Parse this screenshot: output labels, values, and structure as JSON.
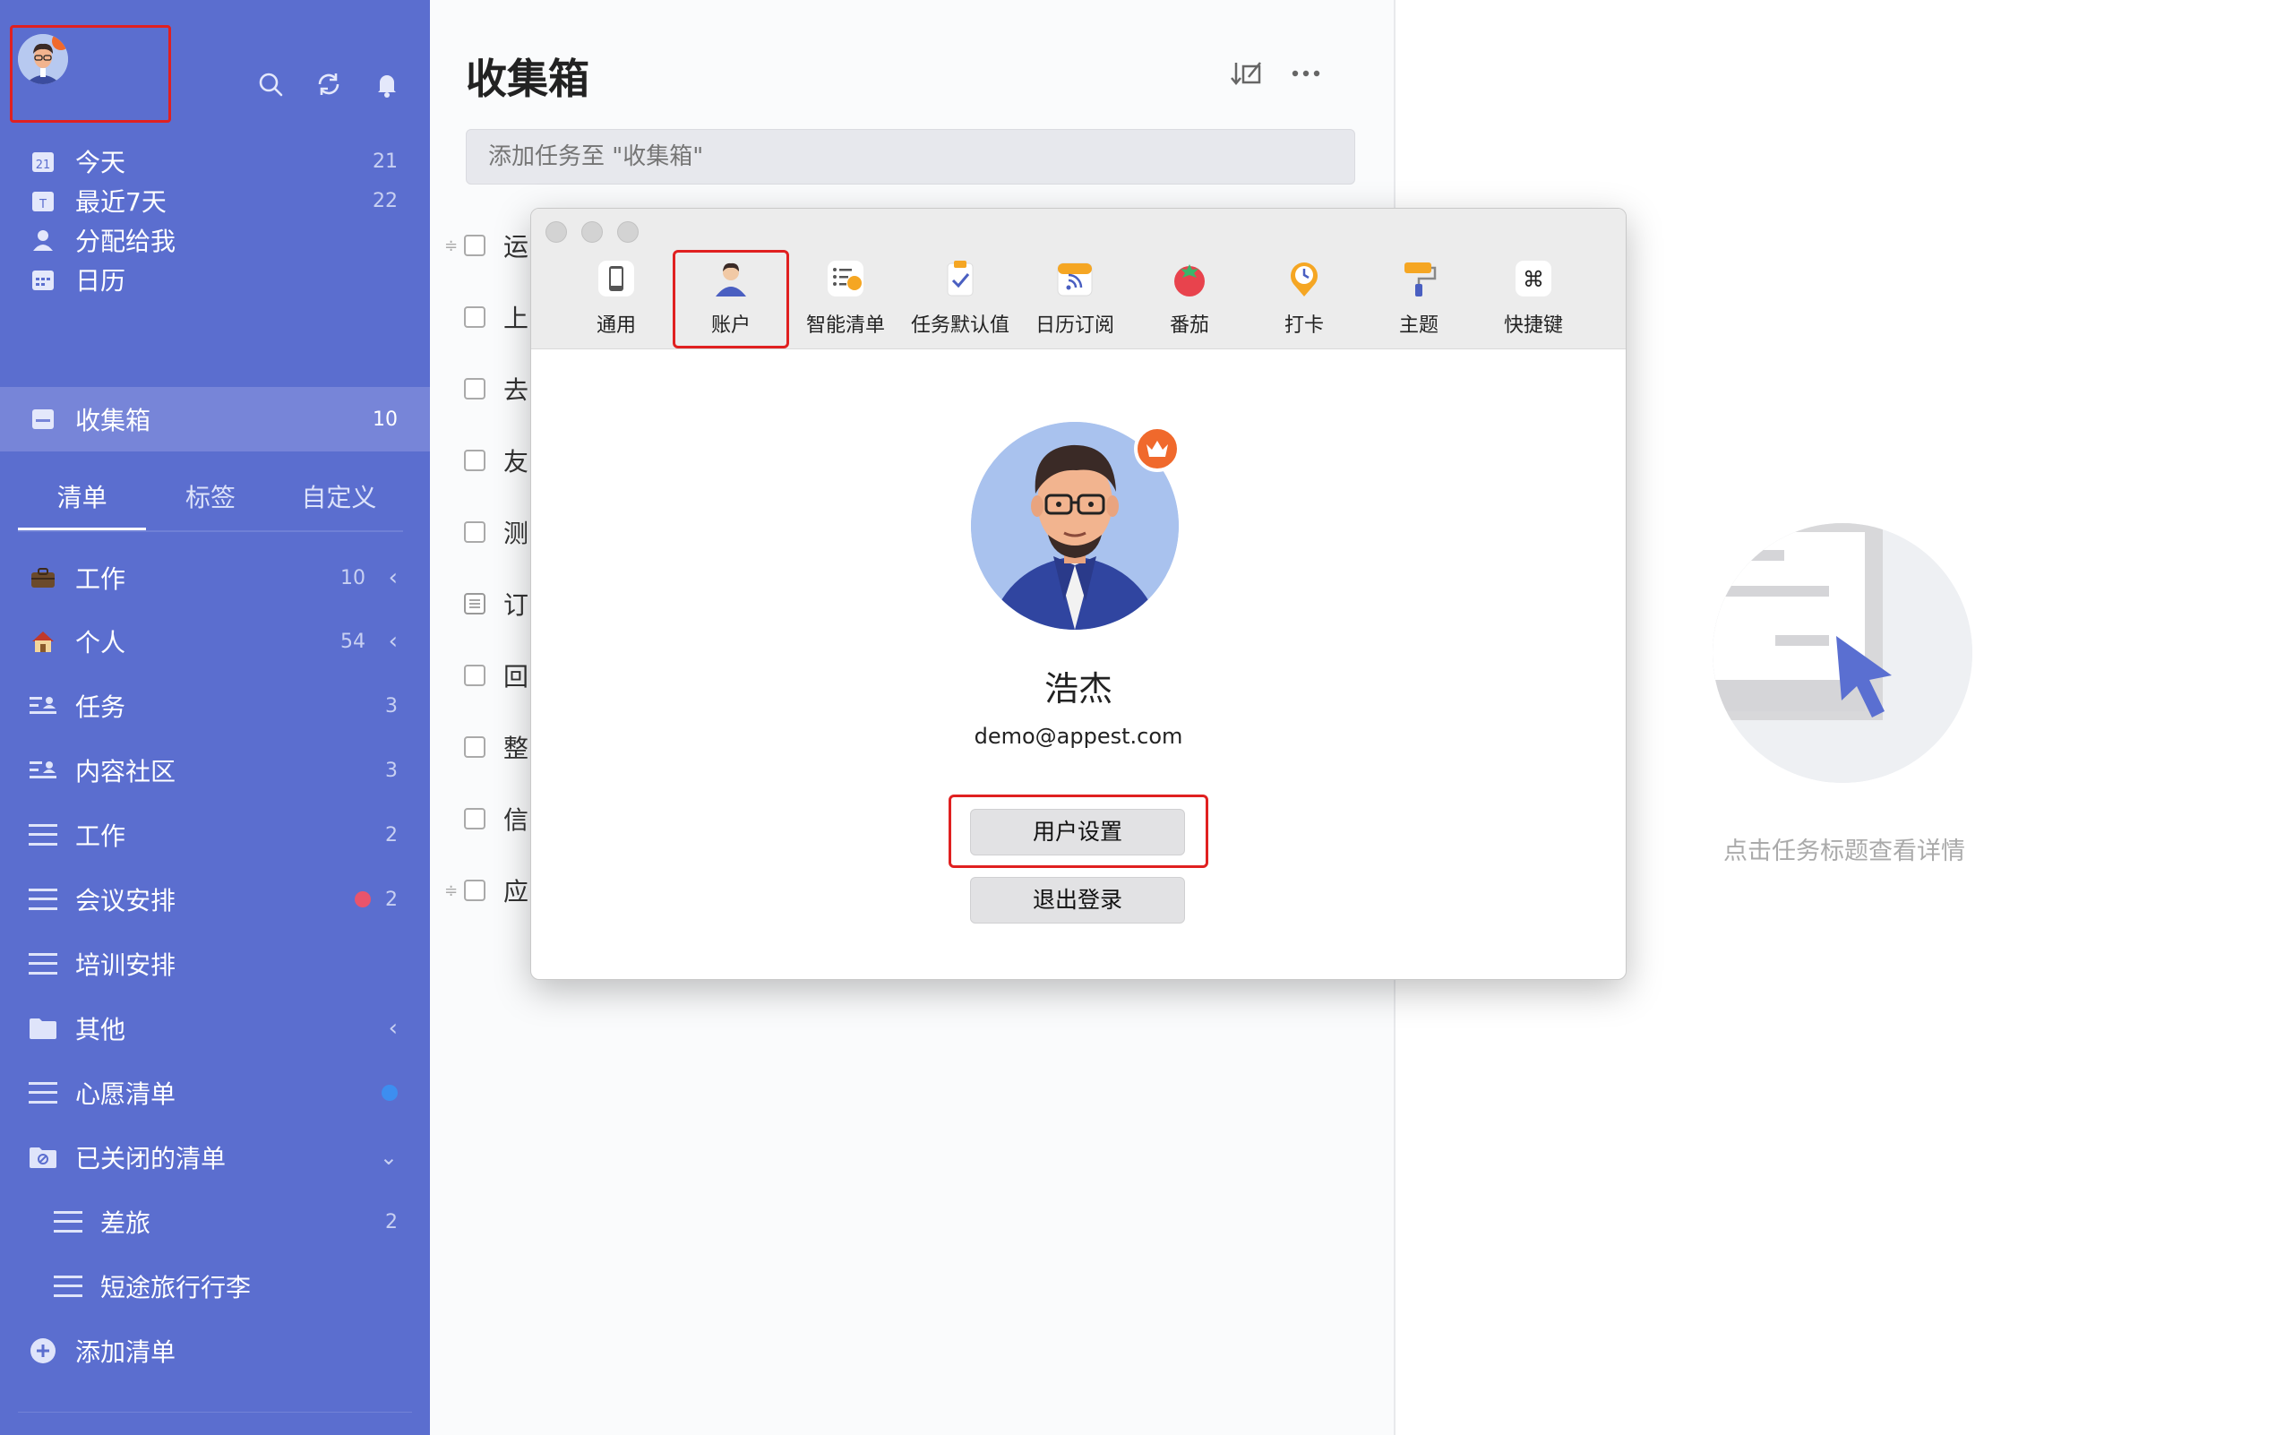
{
  "sidebar": {
    "smart_lists": [
      {
        "label": "今天",
        "count": "21",
        "icon": "calendar-today-icon"
      },
      {
        "label": "最近7天",
        "count": "22",
        "icon": "calendar-week-icon"
      },
      {
        "label": "分配给我",
        "count": "",
        "icon": "person-icon"
      },
      {
        "label": "日历",
        "count": "",
        "icon": "calendar-icon"
      },
      {
        "label": "收集箱",
        "count": "10",
        "icon": "inbox-icon"
      }
    ],
    "tabs": [
      "清单",
      "标签",
      "自定义"
    ],
    "lists": [
      {
        "label": "工作",
        "count": "10",
        "icon": "briefcase-icon"
      },
      {
        "label": "个人",
        "count": "54",
        "icon": "house-icon"
      },
      {
        "label": "任务",
        "count": "3",
        "icon": "shared-list-icon"
      },
      {
        "label": "内容社区",
        "count": "3",
        "icon": "shared-list-icon"
      },
      {
        "label": "工作",
        "count": "2",
        "icon": "list-icon"
      },
      {
        "label": "会议安排",
        "count": "2",
        "icon": "list-icon",
        "dot_color": "#e9546b"
      },
      {
        "label": "培训安排",
        "count": "",
        "icon": "list-icon"
      },
      {
        "label": "其他",
        "count": "",
        "icon": "folder-icon"
      },
      {
        "label": "心愿清单",
        "count": "",
        "icon": "list-icon",
        "dot_color": "#3d8ef0"
      },
      {
        "label": "已关闭的清单",
        "count": "",
        "icon": "closed-folder-icon"
      },
      {
        "label": "差旅",
        "count": "2",
        "icon": "list-icon"
      },
      {
        "label": "短途旅行行李",
        "count": "",
        "icon": "list-icon"
      },
      {
        "label": "添加清单",
        "count": "",
        "icon": "add-circle-icon"
      }
    ]
  },
  "main": {
    "title": "收集箱",
    "add_placeholder": "添加任务至 \"收集箱\"",
    "tasks": [
      "运",
      "上",
      "去",
      "友",
      "测",
      "订",
      "回",
      "整",
      "信",
      "应"
    ]
  },
  "detail": {
    "empty_text": "点击任务标题查看详情"
  },
  "dialog": {
    "toolbar": [
      "通用",
      "账户",
      "智能清单",
      "任务默认值",
      "日历订阅",
      "番茄",
      "打卡",
      "主题",
      "快捷键"
    ],
    "active_tab": "账户",
    "user_name": "浩杰",
    "email": "demo@appest.com",
    "settings_button": "用户设置",
    "logout_button": "退出登录"
  },
  "colors": {
    "sidebar_bg": "#5b6ecf",
    "highlight": "#e02020",
    "crown": "#f0692c"
  }
}
